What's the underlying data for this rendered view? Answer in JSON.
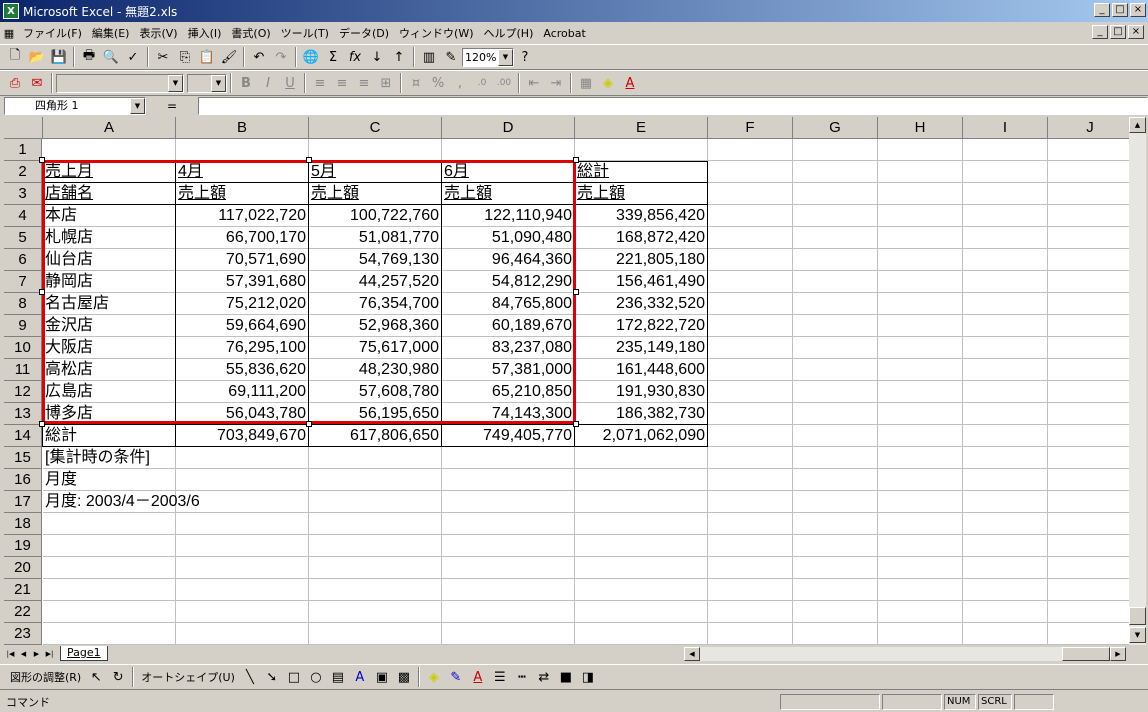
{
  "window": {
    "title": "Microsoft Excel - 無題2.xls",
    "minimize": "_",
    "restore": "□",
    "close": "×"
  },
  "menu": [
    "ファイル(F)",
    "編集(E)",
    "表示(V)",
    "挿入(I)",
    "書式(O)",
    "ツール(T)",
    "データ(D)",
    "ウィンドウ(W)",
    "ヘルプ(H)",
    "Acrobat"
  ],
  "toolbar": {
    "zoom": "120%"
  },
  "formula_bar": {
    "name_box": "四角形 1",
    "equals": "=",
    "value": ""
  },
  "columns": [
    "A",
    "B",
    "C",
    "D",
    "E",
    "F",
    "G",
    "H",
    "I",
    "J"
  ],
  "rows": [
    "1",
    "2",
    "3",
    "4",
    "5",
    "6",
    "7",
    "8",
    "9",
    "10",
    "11",
    "12",
    "13",
    "14",
    "15",
    "16",
    "17",
    "18",
    "19",
    "20",
    "21",
    "22",
    "23"
  ],
  "cells": {
    "r2": [
      "売上月",
      "4月",
      "5月",
      "6月",
      "総計"
    ],
    "r3": [
      "店舗名",
      "売上額",
      "売上額",
      "売上額",
      "売上額"
    ],
    "data": [
      [
        "本店",
        "117,022,720",
        "100,722,760",
        "122,110,940",
        "339,856,420"
      ],
      [
        "札幌店",
        "66,700,170",
        "51,081,770",
        "51,090,480",
        "168,872,420"
      ],
      [
        "仙台店",
        "70,571,690",
        "54,769,130",
        "96,464,360",
        "221,805,180"
      ],
      [
        "静岡店",
        "57,391,680",
        "44,257,520",
        "54,812,290",
        "156,461,490"
      ],
      [
        "名古屋店",
        "75,212,020",
        "76,354,700",
        "84,765,800",
        "236,332,520"
      ],
      [
        "金沢店",
        "59,664,690",
        "52,968,360",
        "60,189,670",
        "172,822,720"
      ],
      [
        "大阪店",
        "76,295,100",
        "75,617,000",
        "83,237,080",
        "235,149,180"
      ],
      [
        "高松店",
        "55,836,620",
        "48,230,980",
        "57,381,000",
        "161,448,600"
      ],
      [
        "広島店",
        "69,111,200",
        "57,608,780",
        "65,210,850",
        "191,930,830"
      ],
      [
        "博多店",
        "56,043,780",
        "56,195,650",
        "74,143,300",
        "186,382,730"
      ]
    ],
    "r14": [
      "総計",
      "703,849,670",
      "617,806,650",
      "749,405,770",
      "2,071,062,090"
    ],
    "r15": "[集計時の条件]",
    "r16": "月度",
    "r17": "月度: 2003/4－2003/6"
  },
  "sheet_tab": "Page1",
  "drawing_toolbar": {
    "adjust": "図形の調整(R)",
    "autoshape": "オートシェイプ(U)"
  },
  "status": {
    "mode": "コマンド",
    "num": "NUM",
    "scrl": "SCRL"
  },
  "colors": {
    "selection_rect": "#e00000",
    "title_start": "#0a246a",
    "title_end": "#a6caf0"
  }
}
